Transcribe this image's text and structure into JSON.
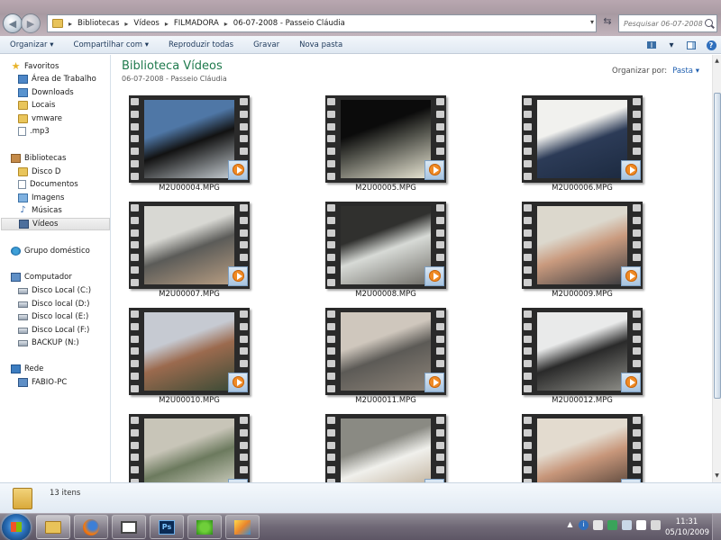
{
  "address": {
    "crumbs": [
      "Bibliotecas",
      "Vídeos",
      "FILMADORA",
      "06-07-2008 - Passeio Cláudia"
    ],
    "search_placeholder": "Pesquisar 06-07-2008 -..."
  },
  "toolbar": {
    "organize": "Organizar ▾",
    "share": "Compartilhar com ▾",
    "play_all": "Reproduzir todas",
    "burn": "Gravar",
    "new_folder": "Nova pasta",
    "help": "?"
  },
  "nav": {
    "favorites_header": "Favoritos",
    "favorites": [
      "Área de Trabalho",
      "Downloads",
      "Locais",
      "vmware",
      ".mp3"
    ],
    "libraries_header": "Bibliotecas",
    "libraries": [
      "Disco D",
      "Documentos",
      "Imagens",
      "Músicas",
      "Vídeos"
    ],
    "homegroup": "Grupo doméstico",
    "computer_header": "Computador",
    "drives": [
      "Disco Local (C:)",
      "Disco local (D:)",
      "Disco local (E:)",
      "Disco Local (F:)",
      "BACKUP (N:)"
    ],
    "network_header": "Rede",
    "network": [
      "FABIO-PC"
    ]
  },
  "library": {
    "title": "Biblioteca Vídeos",
    "subtitle": "06-07-2008 - Passeio Cláudia",
    "arrange_label": "Organizar por:",
    "arrange_value": "Pasta ▾"
  },
  "files": [
    {
      "name": "M2U00004.MPG",
      "palette": [
        "#4f77a6",
        "#121212",
        "#c6cdd2"
      ]
    },
    {
      "name": "M2U00005.MPG",
      "palette": [
        "#0b0b0b",
        "#4e4f48",
        "#e9e6d4"
      ]
    },
    {
      "name": "M2U00006.MPG",
      "palette": [
        "#f1f1ee",
        "#2c3b57",
        "#1c2a40"
      ]
    },
    {
      "name": "M2U00007.MPG",
      "palette": [
        "#d8d8d3",
        "#5b5b58",
        "#b79d82"
      ]
    },
    {
      "name": "M2U00008.MPG",
      "palette": [
        "#30302e",
        "#d7dad6",
        "#6f6d67"
      ]
    },
    {
      "name": "M2U00009.MPG",
      "palette": [
        "#dcd8cd",
        "#c99a7e",
        "#3a3b3f"
      ]
    },
    {
      "name": "M2U00010.MPG",
      "palette": [
        "#c6cad2",
        "#9b6a4e",
        "#3b4b36"
      ]
    },
    {
      "name": "M2U00011.MPG",
      "palette": [
        "#cfc7bd",
        "#5c5a56",
        "#8d8479"
      ]
    },
    {
      "name": "M2U00012.MPG",
      "palette": [
        "#e9eaea",
        "#2a2a2a",
        "#8e8e88"
      ]
    },
    {
      "name": "",
      "palette": [
        "#c8c5b8",
        "#6c7a5e",
        "#e6e3d8"
      ]
    },
    {
      "name": "",
      "palette": [
        "#8a8a83",
        "#f0f0ec",
        "#b6a38a"
      ]
    },
    {
      "name": "",
      "palette": [
        "#e3dbcf",
        "#c7967a",
        "#40342d"
      ]
    }
  ],
  "details": {
    "count": "13 itens"
  },
  "taskbar": {
    "ps_label": "Ps",
    "time": "11:31",
    "date": "05/10/2009"
  }
}
